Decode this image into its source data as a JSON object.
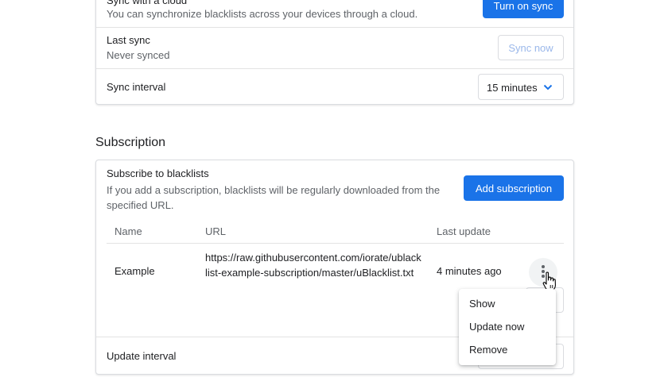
{
  "sync": {
    "title": "Sync with a cloud",
    "description": "You can synchronize blacklists across your devices through a cloud.",
    "turn_on_label": "Turn on sync",
    "last_sync_label": "Last sync",
    "last_sync_value": "Never synced",
    "sync_now_label": "Sync now",
    "interval_label": "Sync interval",
    "interval_value": "15 minutes"
  },
  "subscription": {
    "section_title": "Subscription",
    "title": "Subscribe to blacklists",
    "description": "If you add a subscription, blacklists will be regularly downloaded from the specified URL.",
    "add_label": "Add subscription",
    "columns": [
      "Name",
      "URL",
      "Last update"
    ],
    "rows": [
      {
        "name": "Example",
        "url": "https://raw.githubusercontent.com/iorate/ublacklist-example-subscription/master/uBlacklist.txt",
        "last_update": "4 minutes ago"
      }
    ],
    "update_interval_label": "Update interval"
  },
  "menu": {
    "items": [
      "Show",
      "Update now",
      "Remove"
    ]
  },
  "colors": {
    "accent": "#1a73e8",
    "border": "#dadce0",
    "secondary_text": "#5f6368"
  }
}
